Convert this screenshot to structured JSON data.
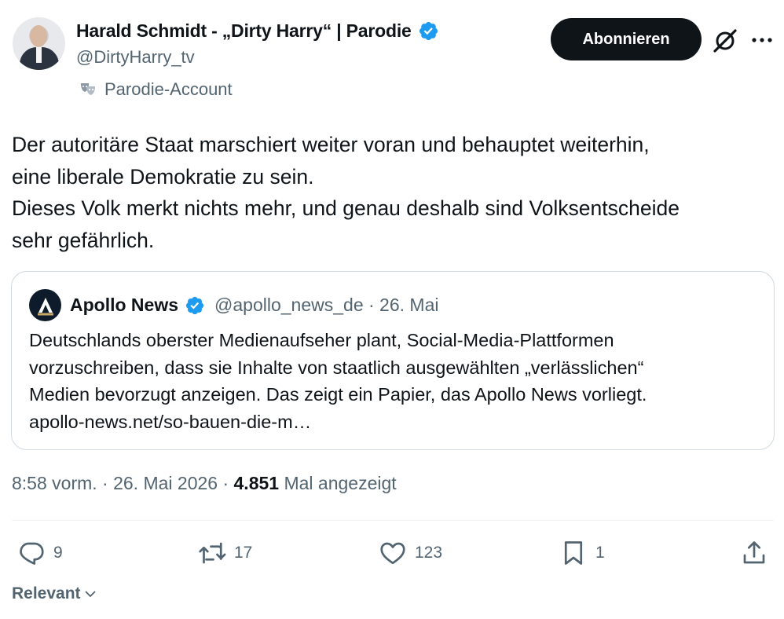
{
  "author": {
    "name": "Harald Schmidt - „Dirty Harry“ | Parodie",
    "handle": "@DirtyHarry_tv",
    "label": "Parodie-Account"
  },
  "actions_top": {
    "follow_label": "Abonnieren"
  },
  "tweet": {
    "lines": [
      "Der autoritäre Staat marschiert weiter voran und behauptet weiterhin,",
      "eine liberale Demokratie zu sein.",
      "Dieses Volk merkt nichts mehr, und genau deshalb sind Volksentscheide",
      "sehr gefährlich."
    ]
  },
  "quote": {
    "name": "Apollo News",
    "handle_date": "@apollo_news_de · 26. Mai",
    "lines": [
      "Deutschlands oberster Medienaufseher plant, Social-Media-Plattformen",
      "vorzuschreiben, dass sie Inhalte von staatlich ausgewählten „verlässlichen“",
      "Medien bevorzugt anzeigen. Das zeigt ein Papier, das Apollo News vorliegt.",
      "apollo-news.net/so-bauen-die-m…"
    ]
  },
  "meta": {
    "time": "8:58 vorm. · 26. Mai 2026 · ",
    "views": "4.851",
    "views_label": " Mal angezeigt"
  },
  "engagement": {
    "replies": "9",
    "retweets": "17",
    "likes": "123",
    "bookmarks": "1"
  },
  "sort": {
    "label": "Relevant"
  },
  "colors": {
    "verified": "#1d9bf0",
    "secondary_text": "#536471",
    "primary_text": "#0f1419",
    "border": "#cfd9de"
  },
  "icons": [
    "verified-badge-icon",
    "parody-mask-icon",
    "grok-icon",
    "more-icon",
    "apollo-logo-icon",
    "reply-icon",
    "retweet-icon",
    "like-icon",
    "bookmark-icon",
    "share-icon",
    "chevron-down-icon"
  ]
}
